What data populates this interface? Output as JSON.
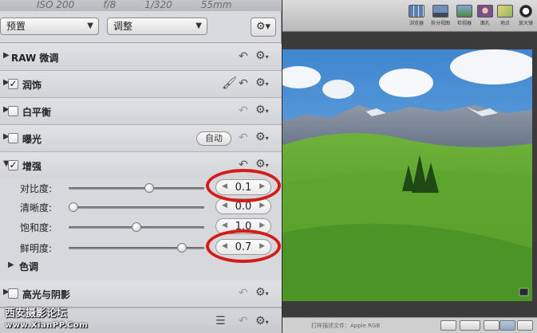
{
  "exif": {
    "iso": "ISO 200",
    "aperture": "f/8",
    "shutter": "1/320",
    "focal": "55mm"
  },
  "selectors": {
    "preset": "预置",
    "adjust": "调整"
  },
  "sections": {
    "raw": "RAW 微调",
    "retouch": "润饰",
    "white_balance": "白平衡",
    "exposure": "曝光",
    "exposure_auto": "自动",
    "enhance": "增强",
    "tone": "色调",
    "highlights_shadows": "高光与阴影"
  },
  "sliders": [
    {
      "label": "对比度:",
      "value": "0.1",
      "fraction": 0.6
    },
    {
      "label": "清晰度:",
      "value": "0.0",
      "fraction": 0.0
    },
    {
      "label": "饱和度:",
      "value": "1.0",
      "fraction": 0.5
    },
    {
      "label": "鲜明度:",
      "value": "0.7",
      "fraction": 0.86
    }
  ],
  "toolbar": {
    "browser": "浏览器",
    "split": "拆分视图",
    "viewer": "检视器",
    "faces": "面孔",
    "places": "地点",
    "loupe": "放大镜"
  },
  "status": {
    "text": "打样描述文件：Apple RGB"
  },
  "watermark": {
    "site": "西安摄影论坛",
    "url": "www.XianPP.Com"
  },
  "colors": {
    "highlight_ring": "#d51a1a",
    "panel_bg": "#d6d8db"
  }
}
